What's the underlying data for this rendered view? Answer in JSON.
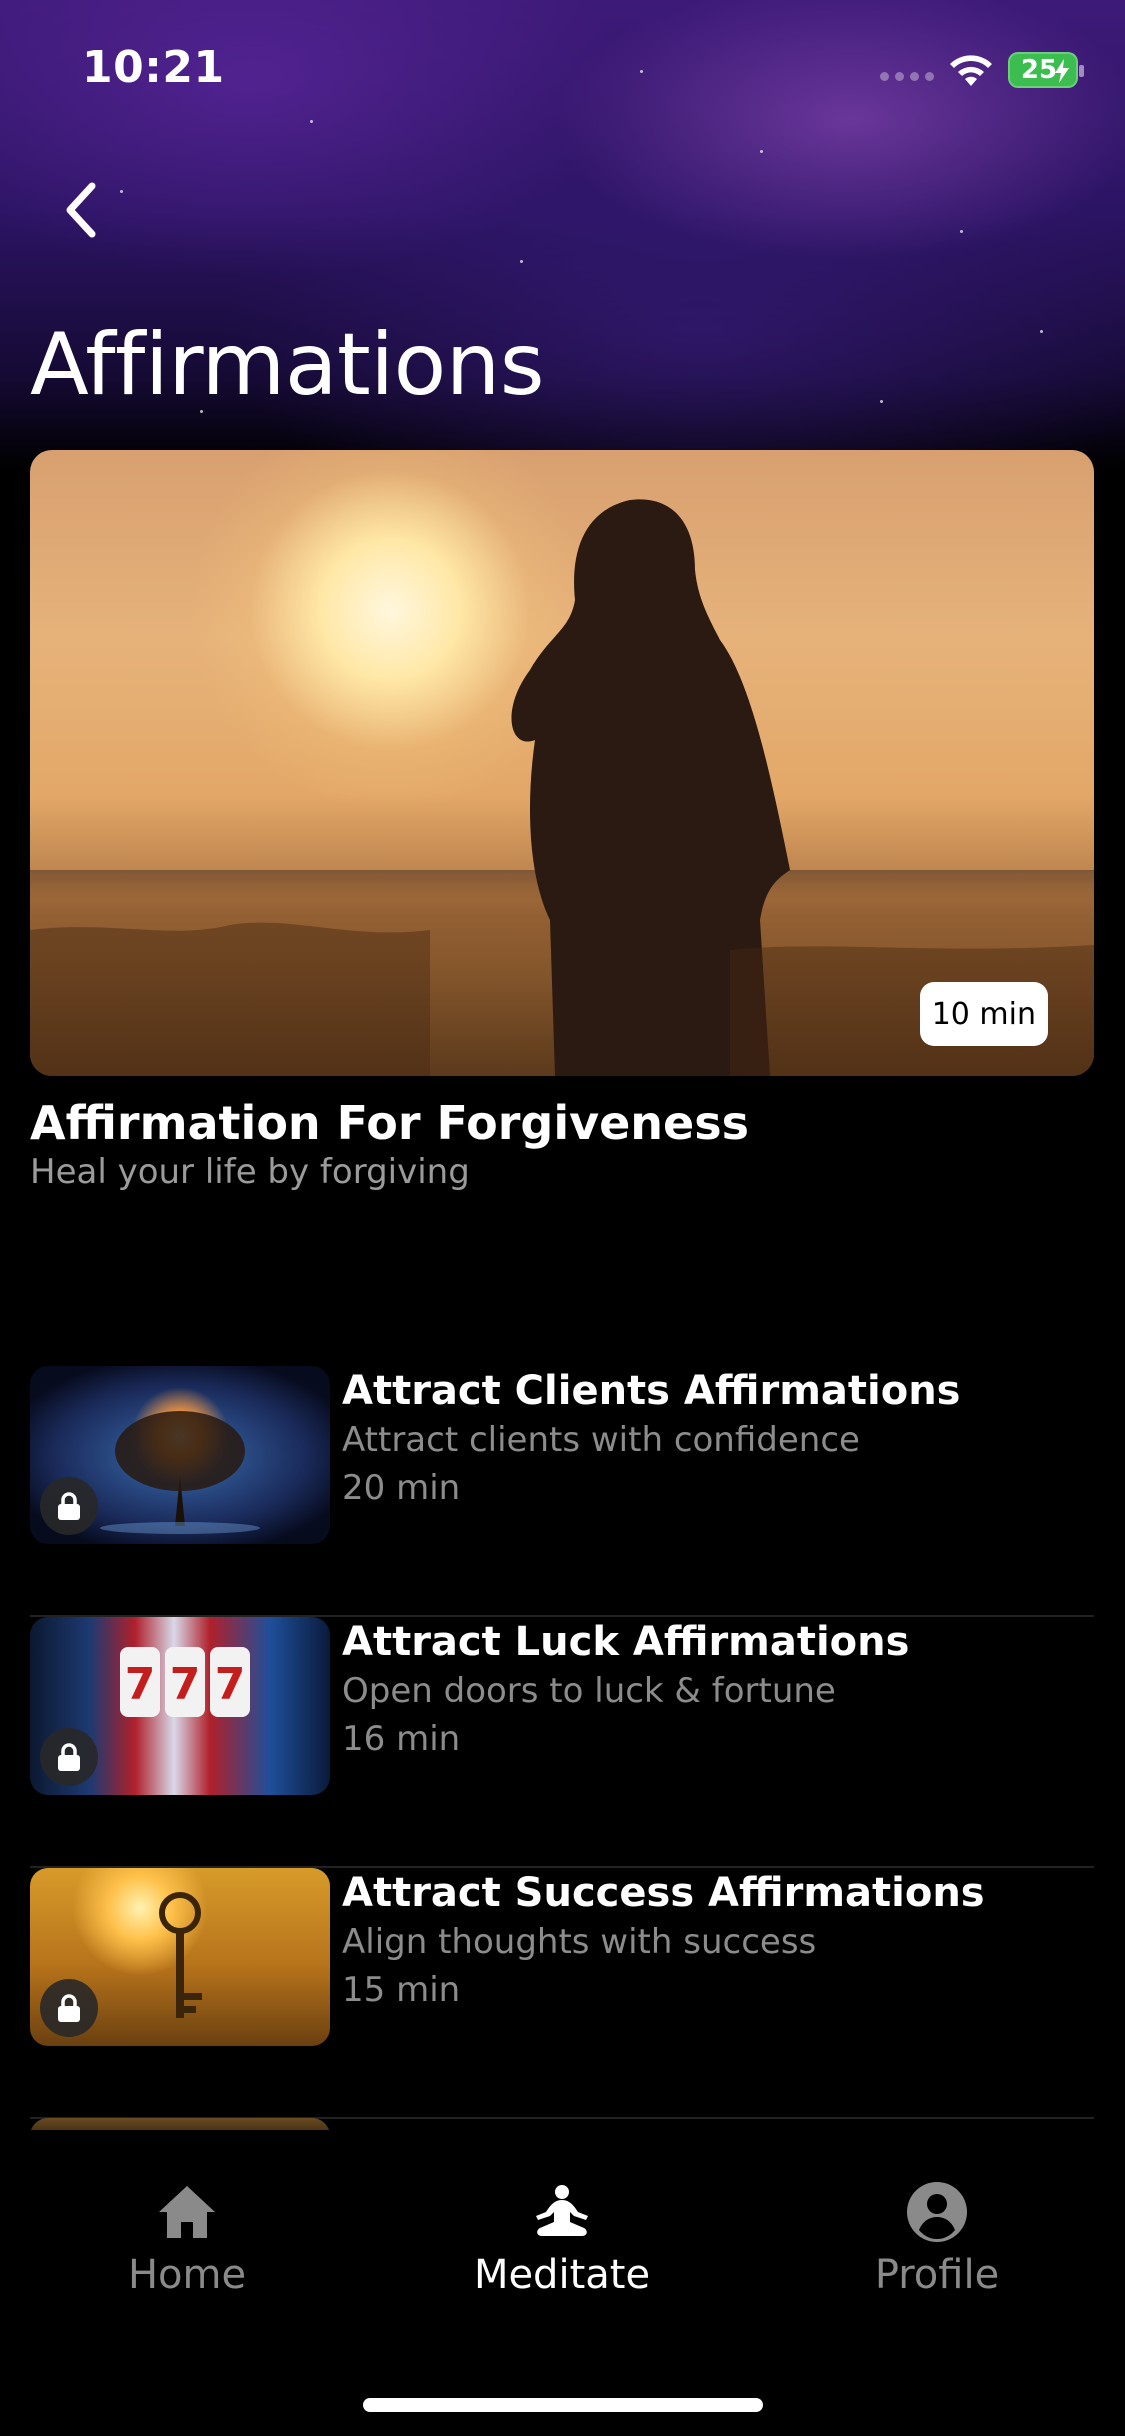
{
  "status_bar": {
    "time": "10:21",
    "battery": "25"
  },
  "header": {
    "title": "Affirmations"
  },
  "featured": {
    "duration": "10 min",
    "title": "Affirmation For Forgiveness",
    "subtitle": "Heal your life by forgiving"
  },
  "list": {
    "items": [
      {
        "title": "Attract Clients Affirmations",
        "subtitle": "Attract clients with confidence",
        "duration": "20 min",
        "locked": true,
        "icon": "lock-icon"
      },
      {
        "title": "Attract Luck Affirmations",
        "subtitle": "Open doors to luck & fortune",
        "duration": "16 min",
        "locked": true,
        "icon": "lock-icon"
      },
      {
        "title": "Attract Success Affirmations",
        "subtitle": "Align thoughts with success",
        "duration": "15 min",
        "locked": true,
        "icon": "lock-icon"
      }
    ]
  },
  "tabs": [
    {
      "label": "Home",
      "icon": "home-icon",
      "active": false
    },
    {
      "label": "Meditate",
      "icon": "meditate-icon",
      "active": true
    },
    {
      "label": "Profile",
      "icon": "profile-icon",
      "active": false
    }
  ],
  "colors": {
    "accent_purple": "#3d1a78",
    "battery_green": "#3bbd4f",
    "muted_text": "#8c8c8c"
  }
}
